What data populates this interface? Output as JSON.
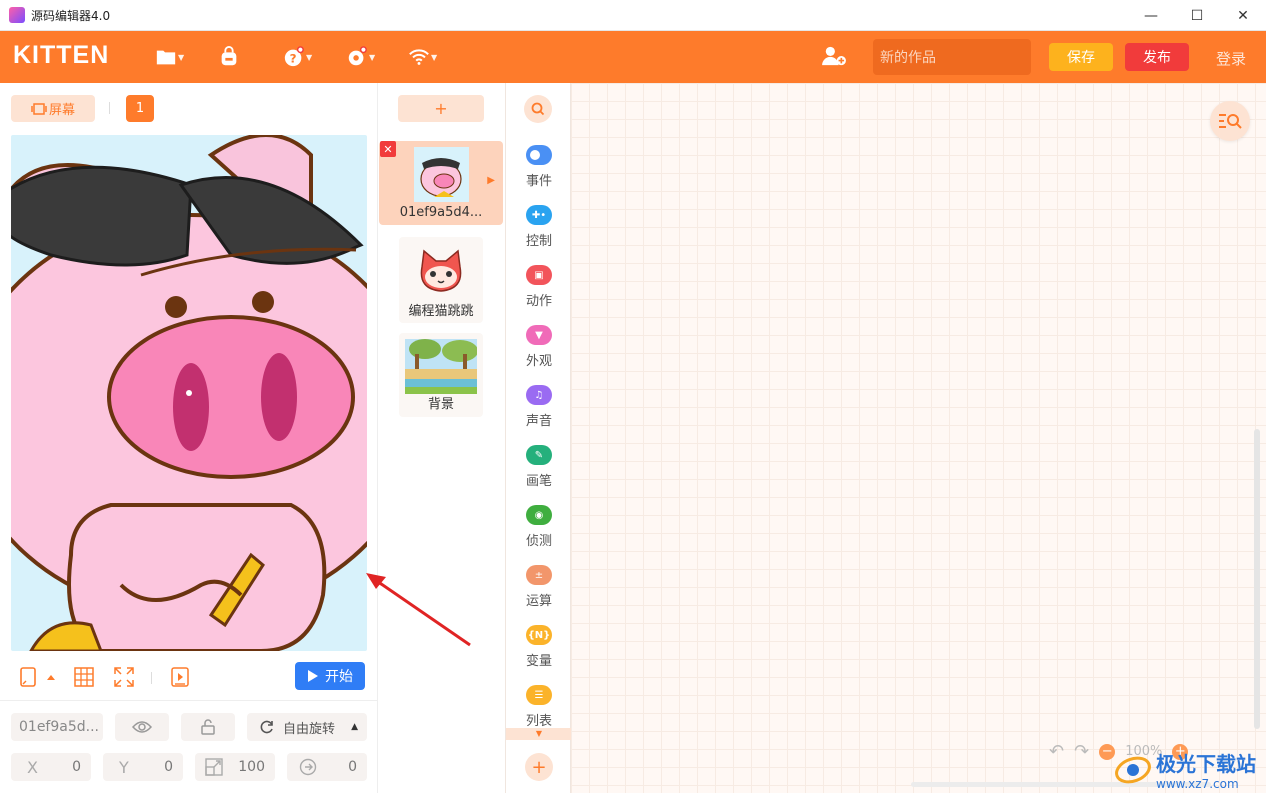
{
  "window": {
    "title": "源码编辑器4.0",
    "controls": [
      "—",
      "☐",
      "✕"
    ]
  },
  "toolbar": {
    "logo": "KITTEN",
    "work_name_placeholder": "新的作品",
    "save_label": "保存",
    "publish_label": "发布",
    "login_label": "登录"
  },
  "stage_panel": {
    "screen_label": "屏幕",
    "scene_number": "1",
    "start_label": "开始",
    "sprite_name": "01ef9a5d...",
    "rotation_label": "自由旋转",
    "x_label": "X",
    "x_value": "0",
    "y_label": "Y",
    "y_value": "0",
    "size_value": "100",
    "direction_value": "0"
  },
  "sprite_panel": {
    "add_label": "+",
    "sprites": [
      {
        "name": "01ef9a5d4...",
        "active": true
      },
      {
        "name": "编程猫跳跳",
        "active": false
      },
      {
        "name": "背景",
        "active": false
      }
    ]
  },
  "categories": [
    {
      "label": "事件",
      "color": "#4a90f4"
    },
    {
      "label": "控制",
      "color": "#2aa3f0"
    },
    {
      "label": "动作",
      "color": "#f2545b"
    },
    {
      "label": "外观",
      "color": "#f06bb8"
    },
    {
      "label": "声音",
      "color": "#9a6bf2"
    },
    {
      "label": "画笔",
      "color": "#25b07c"
    },
    {
      "label": "侦测",
      "color": "#3fae3f"
    },
    {
      "label": "运算",
      "color": "#f2966b"
    },
    {
      "label": "变量",
      "color": "#fbb32a"
    },
    {
      "label": "列表",
      "color": "#fbb32a"
    }
  ],
  "workspace": {
    "zoom_label": "100%"
  },
  "watermark": {
    "brand": "极光下载站",
    "url": "www.xz7.com"
  }
}
